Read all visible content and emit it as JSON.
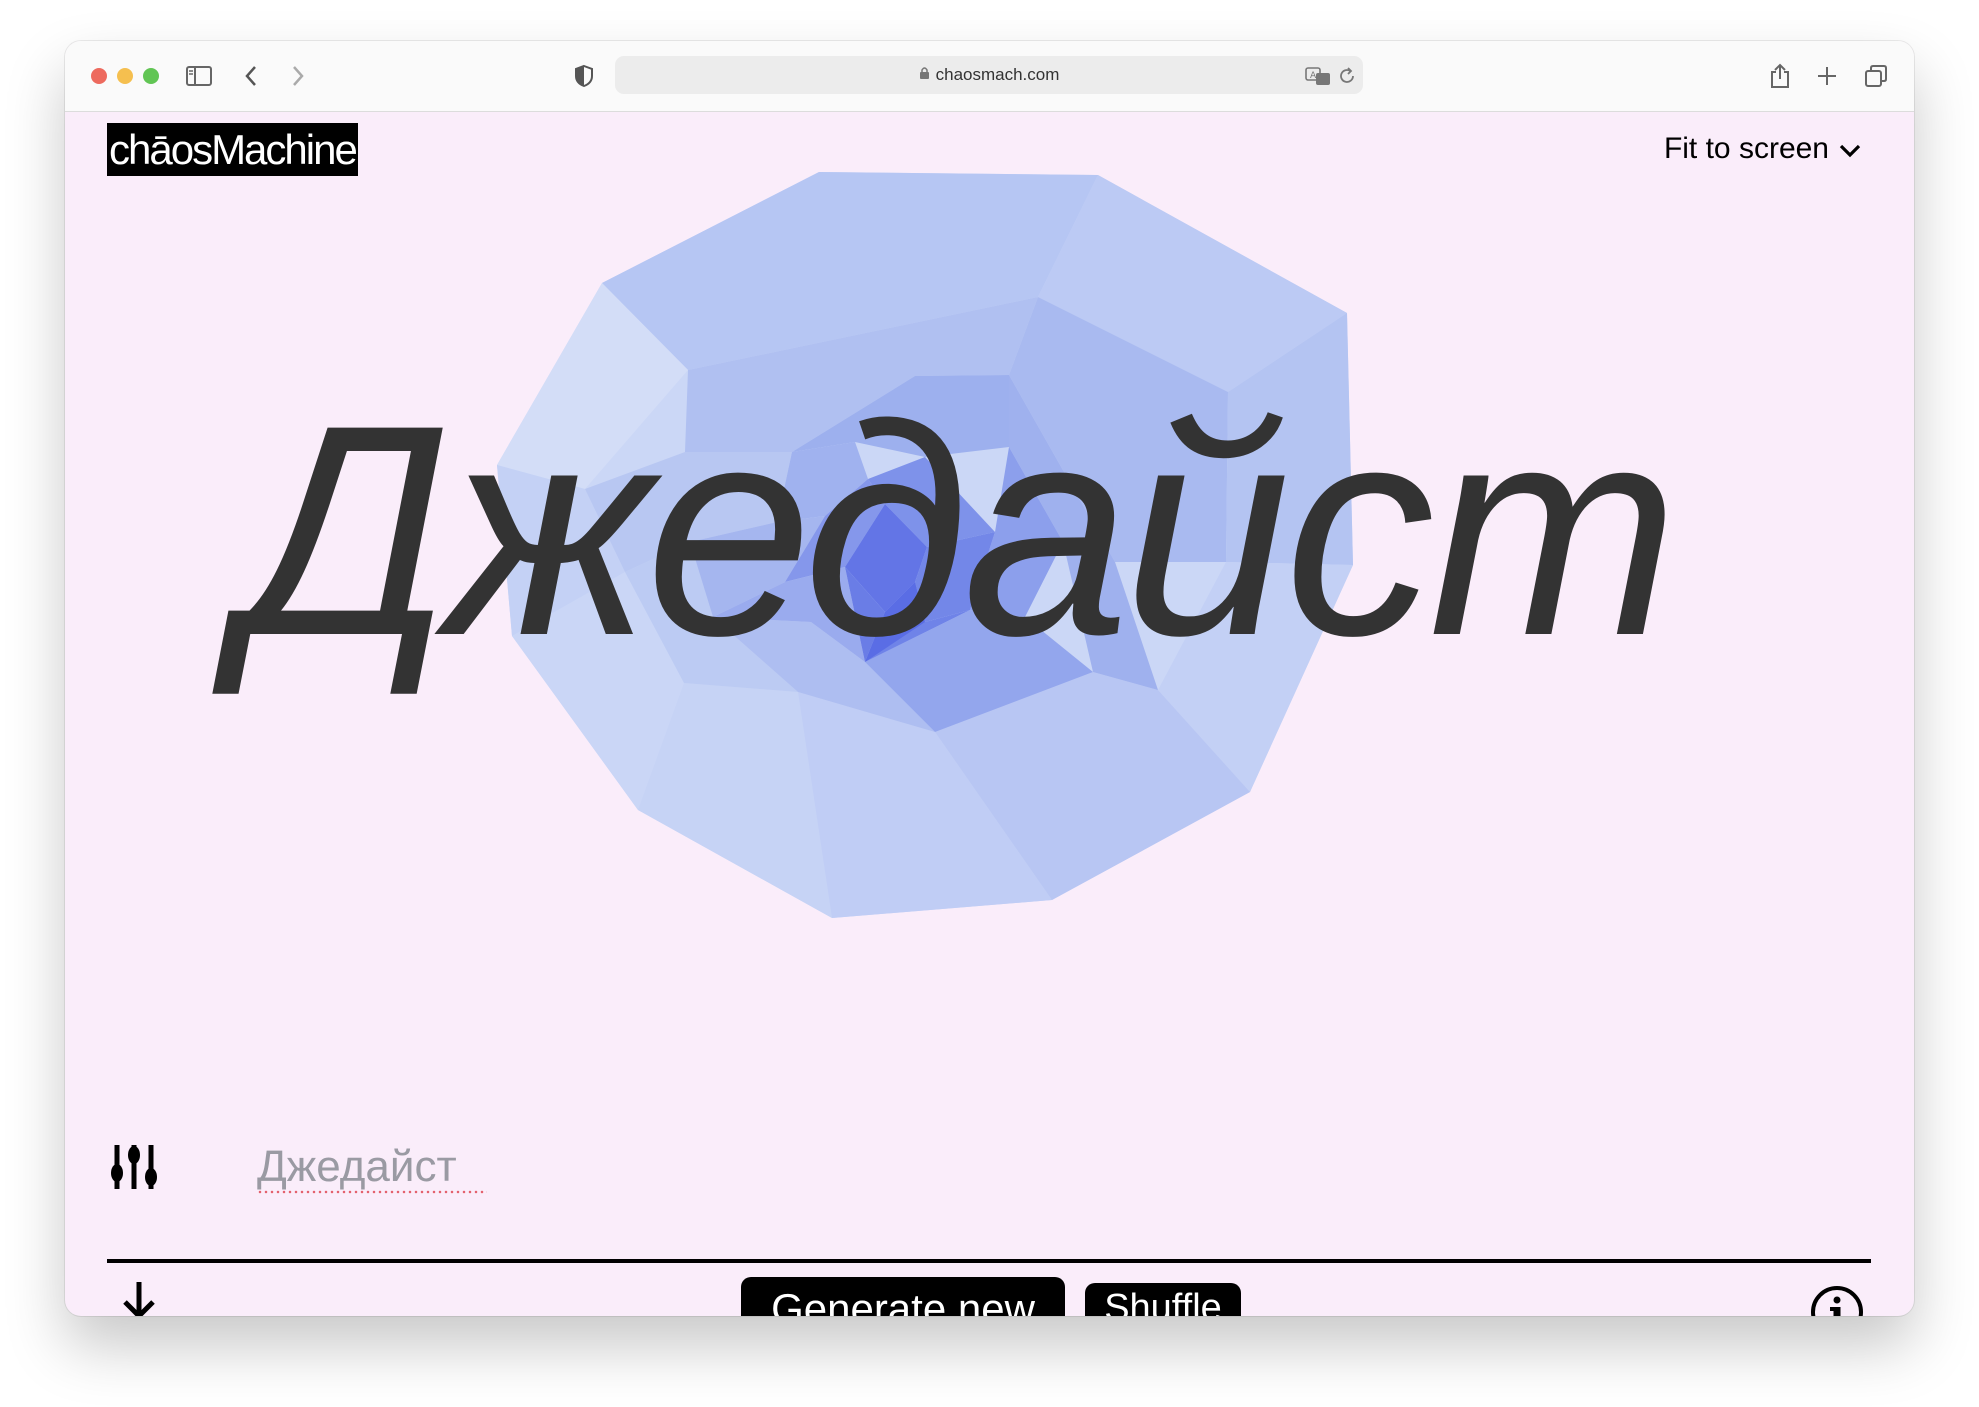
{
  "browser": {
    "url": "chaosmach.com",
    "icons": [
      "sidebar-icon",
      "back-icon",
      "forward-icon",
      "shield-icon",
      "lock-icon",
      "translate-icon",
      "reload-icon",
      "share-icon",
      "new-tab-icon",
      "tabs-icon"
    ]
  },
  "app": {
    "logo": "chāosMachine",
    "fit_label": "Fit to screen",
    "display_text": "Джедайст",
    "input": {
      "value": "Джедайст",
      "placeholder": "Джедайст"
    },
    "buttons": {
      "generate": "Generate new",
      "shuffle": "Shuffle"
    },
    "icons": [
      "sliders-icon",
      "download-icon",
      "info-icon",
      "chevron-down-icon"
    ],
    "colors": {
      "background": "#faedfa",
      "shape_light": "#c9d6f5",
      "shape_dark": "#5b6ce8",
      "text": "#333333"
    }
  }
}
